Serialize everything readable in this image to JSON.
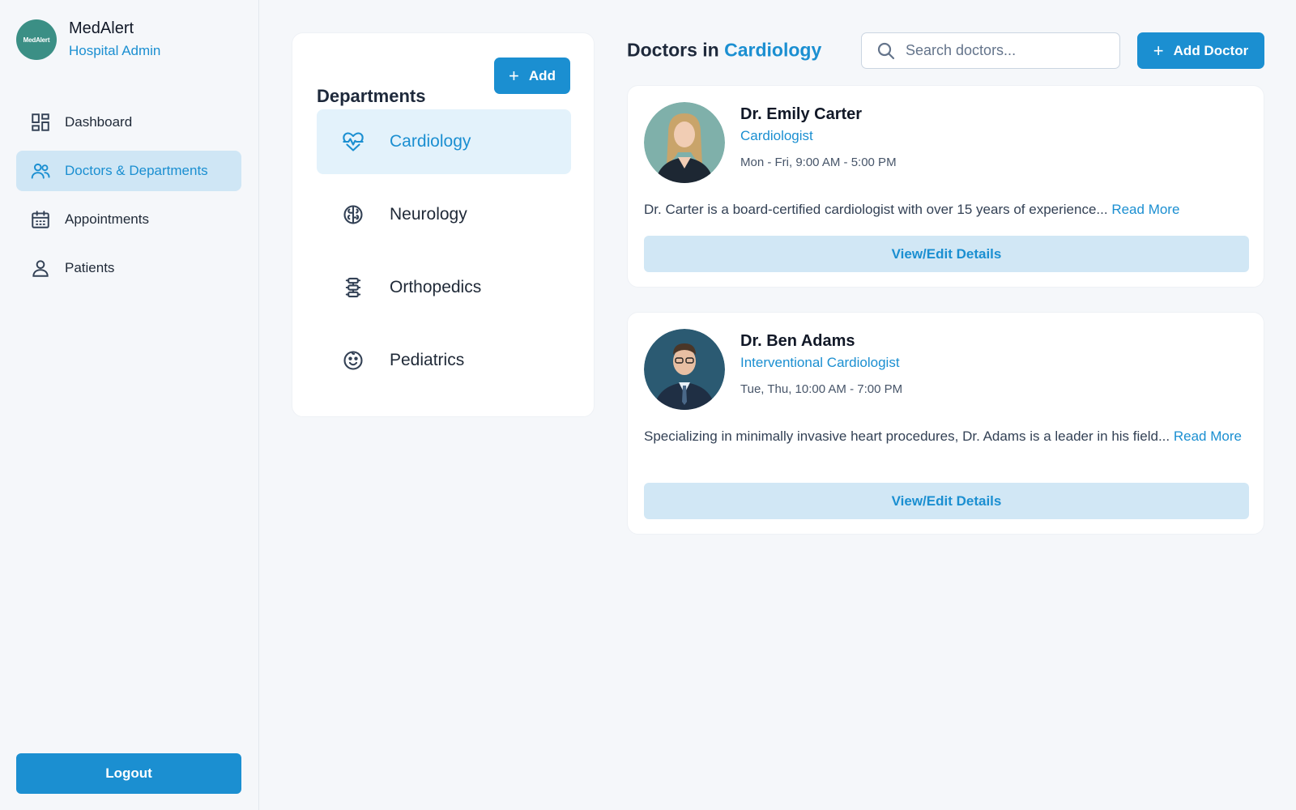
{
  "brand": {
    "logo_text": "MedAlert",
    "name": "MedAlert",
    "role": "Hospital Admin"
  },
  "nav": {
    "items": [
      {
        "label": "Dashboard",
        "icon": "dashboard-icon"
      },
      {
        "label": "Doctors & Departments",
        "icon": "users-icon",
        "active": true
      },
      {
        "label": "Appointments",
        "icon": "calendar-icon"
      },
      {
        "label": "Patients",
        "icon": "person-icon"
      }
    ],
    "logout_label": "Logout"
  },
  "departments": {
    "title": "Departments",
    "add_label": "Add",
    "items": [
      {
        "label": "Cardiology",
        "icon": "heartbeat-icon",
        "active": true
      },
      {
        "label": "Neurology",
        "icon": "brain-icon"
      },
      {
        "label": "Orthopedics",
        "icon": "spine-icon"
      },
      {
        "label": "Pediatrics",
        "icon": "smiley-face-icon"
      }
    ]
  },
  "main": {
    "title_prefix": "Doctors in",
    "title_department": "Cardiology",
    "search_placeholder": "Search doctors...",
    "add_doctor_label": "Add Doctor"
  },
  "doctors": [
    {
      "name": "Dr. Emily Carter",
      "specialty": "Cardiologist",
      "hours": "Mon - Fri, 9:00 AM - 5:00 PM",
      "bio": "Dr. Carter is a board-certified cardiologist with over 15 years of experience...",
      "read_more": "Read More",
      "button": "View/Edit Details"
    },
    {
      "name": "Dr. Ben Adams",
      "specialty": "Interventional Cardiologist",
      "hours": "Tue, Thu, 10:00 AM - 7:00 PM",
      "bio": "Specializing in minimally invasive heart procedures, Dr. Adams is a leader in his field...",
      "read_more": "Read More",
      "button": "View/Edit Details"
    }
  ],
  "colors": {
    "accent": "#1b8fd1",
    "accent_light": "#cfe6f5",
    "logo_bg": "#3b8f85"
  }
}
